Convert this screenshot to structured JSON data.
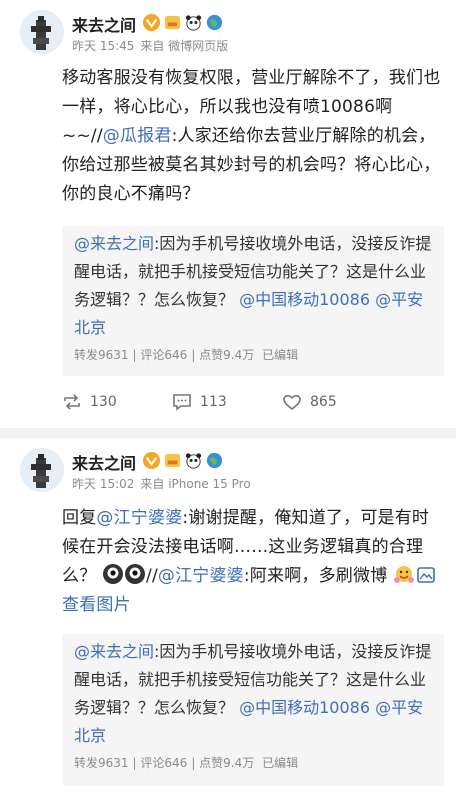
{
  "posts": [
    {
      "author": "来去之间",
      "time": "昨天 15:45",
      "source": "来自 微博网页版",
      "body_parts": {
        "t1": "移动客服没有恢复权限，营业厅解除不了，我们也一样，将心比心，所以我也没有喷10086啊~~//",
        "m1": "@瓜报君",
        "t2": ":人家还给你去营业厅解除的机会，你给过那些被莫名其妙封号的机会吗？将心比心，你的良心不痛吗？"
      },
      "quote": {
        "mention": "@来去之间",
        "text": ":因为手机号接收境外电话，没接反诈提醒电话，就把手机接受短信功能关了？这是什么业务逻辑？？怎么恢复？",
        "m2": "@中国移动10086",
        "m3": "@平安北京",
        "reposts": "转发9631",
        "comments": "评论646",
        "likes": "点赞9.4万",
        "edited": "已编辑"
      },
      "actions": {
        "repost": "130",
        "comment": "113",
        "like": "865"
      }
    },
    {
      "author": "来去之间",
      "time": "昨天 15:02",
      "source": "来自 iPhone 15 Pro",
      "body_parts": {
        "t0": "回复",
        "m0": "@江宁婆婆",
        "t1": ":谢谢提醒，俺知道了，可是有时候在开会没法接电话啊……这业务逻辑真的合理么？",
        "t1b": "//",
        "m1": "@江宁婆婆",
        "t2": ":阿来啊，多刷微博",
        "link": "查看图片"
      },
      "quote": {
        "mention": "@来去之间",
        "text": ":因为手机号接收境外电话，没接反诈提醒电话，就把手机接受短信功能关了？这是什么业务逻辑？？怎么恢复？",
        "m2": "@中国移动10086",
        "m3": "@平安北京",
        "reposts": "转发9631",
        "comments": "评论646",
        "likes": "点赞9.4万",
        "edited": "已编辑"
      }
    }
  ],
  "icons": [
    "vip-badge",
    "gold-badge",
    "panda-badge",
    "globe-badge",
    "repost-icon",
    "comment-icon",
    "like-icon",
    "picture-icon"
  ],
  "colors": {
    "mention": "#3d6fb8",
    "meta": "#8b8b8b",
    "quote_bg": "#f5f5f5",
    "separator": "#f2f2f2"
  }
}
